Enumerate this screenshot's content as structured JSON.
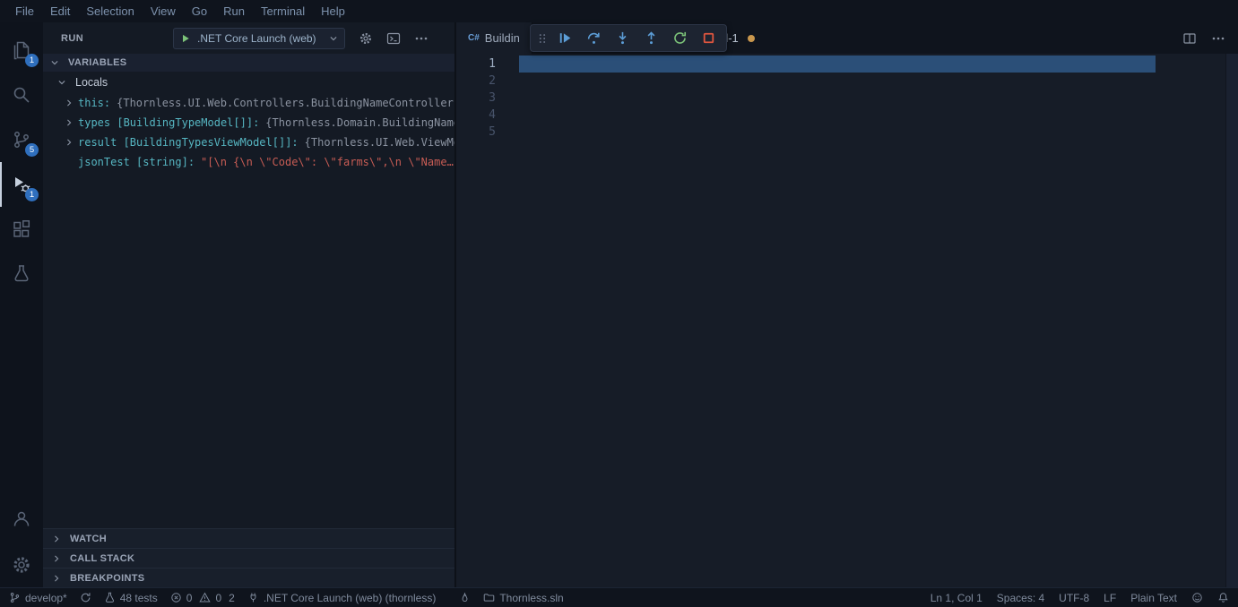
{
  "colors": {
    "accent_blue": "#2f6fbd",
    "icon_blue": "#5c9dd6",
    "green": "#7cc379",
    "stop_red": "#e0563f",
    "variable_cyan": "#56b6c2",
    "string_red": "#c75c54",
    "selection_blue": "#2b4f78"
  },
  "menu_bar": {
    "items": [
      "File",
      "Edit",
      "Selection",
      "View",
      "Go",
      "Run",
      "Terminal",
      "Help"
    ]
  },
  "activity_bar": {
    "badges": {
      "explorer": "1",
      "source_control": "5",
      "debug": "1"
    }
  },
  "run_panel": {
    "header": {
      "title": "RUN",
      "config_label": ".NET Core Launch (web)"
    },
    "sections": {
      "variables": "VARIABLES",
      "watch": "WATCH",
      "call_stack": "CALL STACK",
      "breakpoints": "BREAKPOINTS"
    },
    "scope": "Locals",
    "variables": [
      {
        "label": "this:",
        "value": "{Thornless.UI.Web.Controllers.BuildingNameController}"
      },
      {
        "label": "types [BuildingTypeModel[]]:",
        "value": "{Thornless.Domain.BuildingNames.Mod…"
      },
      {
        "label": "result [BuildingTypesViewModel[]]:",
        "value": "{Thornless.UI.Web.ViewModels.…"
      },
      {
        "label": "jsonTest [string]:",
        "value": "\"[\\n  {\\n    \\\"Code\\\": \\\"farms\\\",\\n    \\\"Name…"
      }
    ]
  },
  "editor": {
    "tabs": [
      {
        "label": "Buildin",
        "icon_text": "C#"
      },
      {
        "label": "d-1",
        "modified": true
      }
    ],
    "line_numbers": [
      "1",
      "2",
      "3",
      "4",
      "5"
    ]
  },
  "status_bar": {
    "branch": "develop*",
    "tests": "48 tests",
    "errors": "0",
    "warnings": "0",
    "other_count": "2",
    "debug_target": ".NET Core Launch (web) (thornless)",
    "solution": "Thornless.sln",
    "cursor": "Ln 1, Col 1",
    "indentation": "Spaces: 4",
    "encoding": "UTF-8",
    "eol": "LF",
    "language": "Plain Text"
  }
}
